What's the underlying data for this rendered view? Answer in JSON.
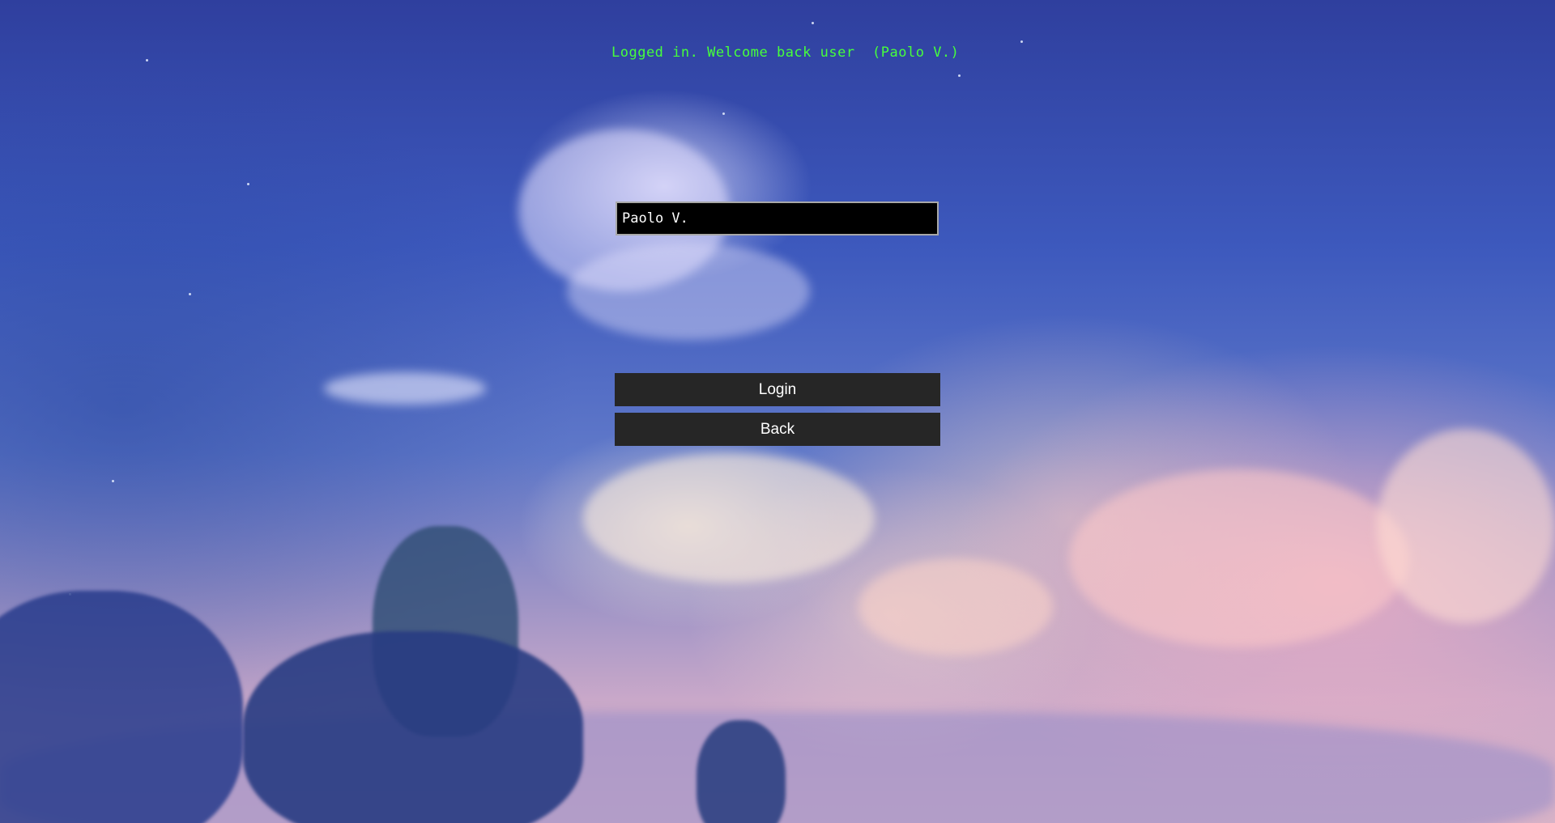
{
  "status": {
    "message": "Logged in. Welcome back user  (Paolo V.)",
    "color": "#46ff3c"
  },
  "login_form": {
    "username_value": "Paolo V.",
    "login_label": "Login",
    "back_label": "Back"
  },
  "colors": {
    "button_background": "#262626",
    "input_background": "#000000",
    "input_border": "#a8a8a8",
    "text": "#ffffff"
  }
}
